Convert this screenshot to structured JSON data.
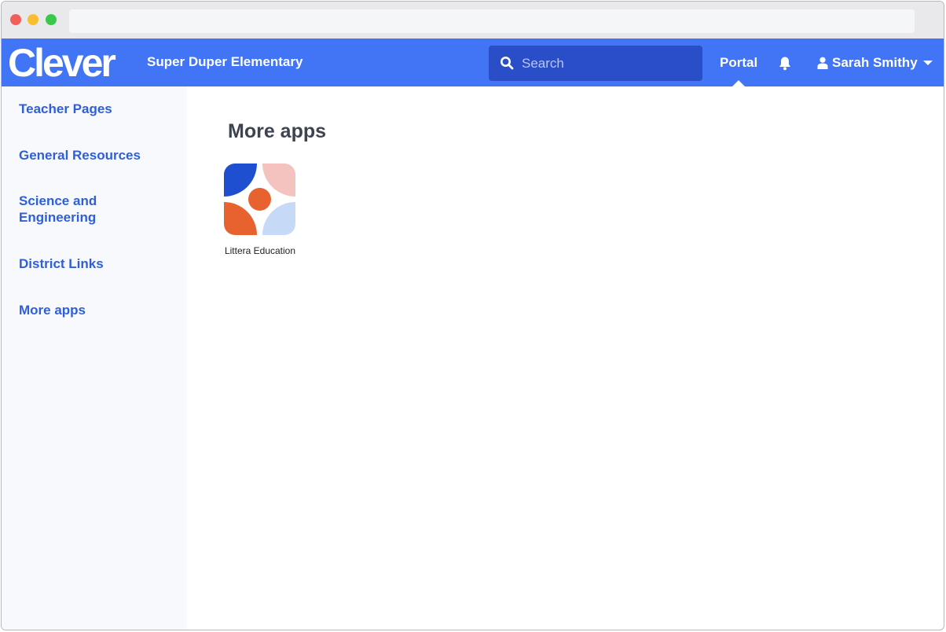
{
  "brand": {
    "logo_text": "Clever",
    "accent": "#4274f6"
  },
  "header": {
    "school_name": "Super Duper Elementary",
    "search_placeholder": "Search",
    "portal_label": "Portal",
    "user_name": "Sarah Smithy"
  },
  "sidebar": {
    "items": [
      {
        "label": "Teacher Pages"
      },
      {
        "label": "General Resources"
      },
      {
        "label": "Science and Engineering"
      },
      {
        "label": "District Links"
      },
      {
        "label": "More apps"
      }
    ]
  },
  "main": {
    "title": "More apps",
    "apps": [
      {
        "name": "Littera Education",
        "icon": "littera-logo-icon"
      }
    ]
  },
  "icons": {
    "search": "search-icon",
    "notifications": "bell-icon",
    "user": "user-icon",
    "dropdown": "chevron-down-icon"
  }
}
